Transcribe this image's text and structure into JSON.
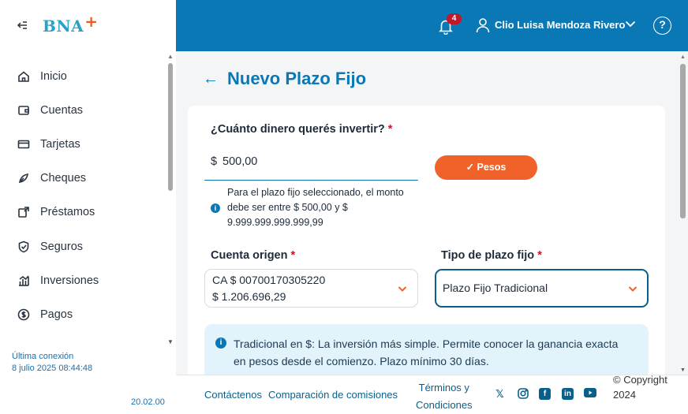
{
  "app": {
    "logo_text": "BNA",
    "logo_plus": "+"
  },
  "sidebar": {
    "items": [
      {
        "label": "Inicio",
        "icon": "home-icon"
      },
      {
        "label": "Cuentas",
        "icon": "wallet-icon"
      },
      {
        "label": "Tarjetas",
        "icon": "card-icon"
      },
      {
        "label": "Cheques",
        "icon": "pen-icon"
      },
      {
        "label": "Préstamos",
        "icon": "loan-icon"
      },
      {
        "label": "Seguros",
        "icon": "shield-icon"
      },
      {
        "label": "Inversiones",
        "icon": "chart-icon"
      },
      {
        "label": "Pagos",
        "icon": "dollar-icon"
      }
    ],
    "last_conn_label": "Última conexión",
    "last_conn_value": "8 julio 2025 08:44:48",
    "version": "20.02.00"
  },
  "topbar": {
    "notifications_count": "4",
    "user_name": "Clio Luisa Mendoza Rivero",
    "help": "?"
  },
  "page": {
    "title": "Nuevo Plazo Fijo",
    "amount_question": "¿Cuánto dinero querés invertir?",
    "required_mark": "*",
    "currency_symbol": "$",
    "amount_value": "500,00",
    "currency_button": "✓ Pesos",
    "hint": "Para el plazo fijo seleccionado, el monto debe ser entre $ 500,00 y $ 9.999.999.999.999,99",
    "origin_label": "Cuenta origen",
    "origin_line1": "CA $ 00700170305220",
    "origin_line2": "$ 1.206.696,29",
    "type_label": "Tipo de plazo fijo",
    "type_value": "Plazo Fijo Tradicional",
    "info_text": "Tradicional en $: La inversión más simple. Permite conocer la ganancia exacta en pesos desde el comienzo. Plazo mínimo 30 días."
  },
  "footer": {
    "contact": "Contáctenos",
    "fees": "Comparación de comisiones",
    "terms_line1": "Términos y",
    "terms_line2": "Condiciones",
    "copyright": "© Copyright 2024",
    "social": [
      "x-icon",
      "instagram-icon",
      "facebook-icon",
      "linkedin-icon",
      "youtube-icon"
    ]
  },
  "colors": {
    "brand_blue": "#0a78b4",
    "accent_orange": "#f0622a",
    "required_red": "#c0172b"
  }
}
